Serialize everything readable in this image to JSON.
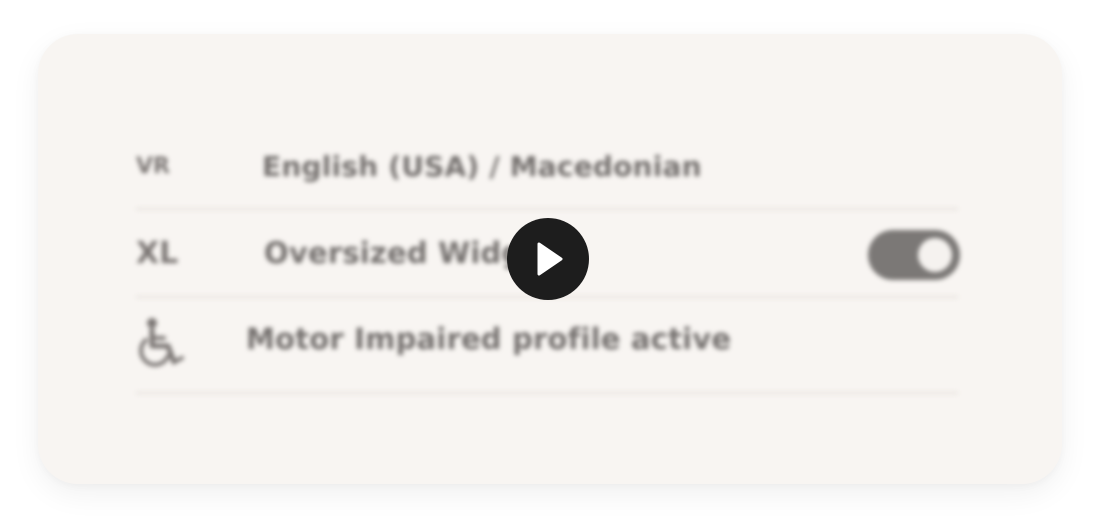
{
  "settings": {
    "rows": [
      {
        "lead": "VR",
        "label": "English (USA) / Macedonian"
      },
      {
        "lead": "XL",
        "label": "Oversized Widgets",
        "toggle_on": true
      },
      {
        "lead_icon": "wheelchair-icon",
        "label": "Motor Impaired profile active"
      }
    ]
  },
  "overlay": {
    "play_icon": "play-icon"
  },
  "colors": {
    "card": "#f8f5f2",
    "text": "#74706e",
    "toggle": "#7b7876",
    "play": "#1d1d1d"
  }
}
